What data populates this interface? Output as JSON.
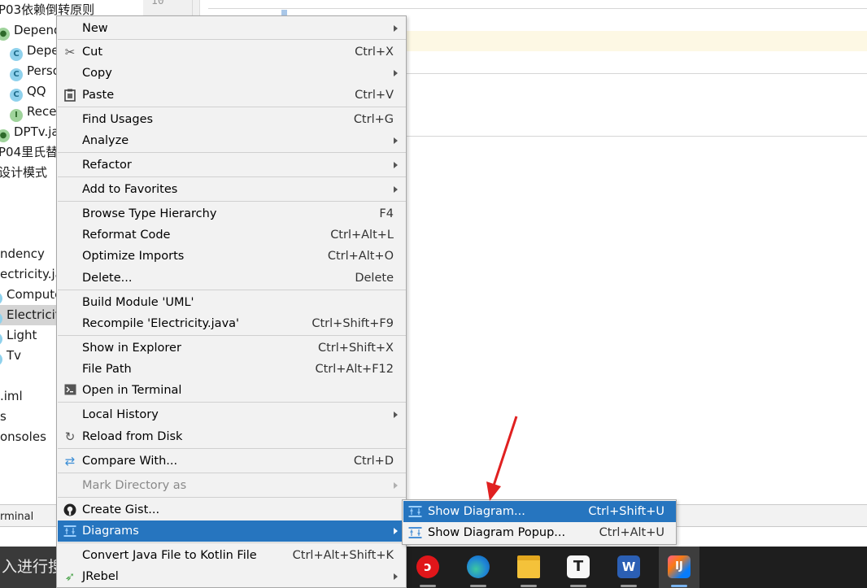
{
  "tree": {
    "rows": [
      {
        "label": "P03依赖倒转原则",
        "icon": ""
      },
      {
        "label": "Depend",
        "icon": "g"
      },
      {
        "label": "Depe",
        "icon": "c"
      },
      {
        "label": "Perso",
        "icon": "c"
      },
      {
        "label": "QQ",
        "icon": "c"
      },
      {
        "label": "Rece",
        "icon": "i"
      },
      {
        "label": "DPTv.jav",
        "icon": ""
      },
      {
        "label": "P04里氏替换",
        "icon": ""
      },
      {
        "label": "设计模式",
        "icon": ""
      },
      {
        "label": "ndency",
        "icon": ""
      },
      {
        "label": "ectricity.ja",
        "icon": ""
      },
      {
        "label": "Compute",
        "icon": "c"
      },
      {
        "label": "Electricit",
        "icon": "c"
      },
      {
        "label": "Light",
        "icon": "c"
      },
      {
        "label": "Tv",
        "icon": "c"
      },
      {
        "label": ".iml",
        "icon": ""
      },
      {
        "label": "s",
        "icon": ""
      },
      {
        "label": "onsoles",
        "icon": ""
      }
    ]
  },
  "gutter": {
    "line_number": "10"
  },
  "bottom": {
    "terminal_tab": "rminal"
  },
  "taskbar": {
    "search_text": "入进行搜索"
  },
  "context_menu": {
    "items": [
      {
        "label": "New",
        "shortcut": "",
        "submenu": true
      },
      {
        "label": "Cut",
        "shortcut": "Ctrl+X",
        "icon": "✂"
      },
      {
        "label": "Copy",
        "shortcut": "",
        "submenu": true
      },
      {
        "label": "Paste",
        "shortcut": "Ctrl+V",
        "icon": "📋"
      },
      {
        "label": "Find Usages",
        "shortcut": "Ctrl+G"
      },
      {
        "label": "Analyze",
        "shortcut": "",
        "submenu": true
      },
      {
        "label": "Refactor",
        "shortcut": "",
        "submenu": true
      },
      {
        "label": "Add to Favorites",
        "shortcut": "",
        "submenu": true
      },
      {
        "label": "Browse Type Hierarchy",
        "shortcut": "F4"
      },
      {
        "label": "Reformat Code",
        "shortcut": "Ctrl+Alt+L"
      },
      {
        "label": "Optimize Imports",
        "shortcut": "Ctrl+Alt+O"
      },
      {
        "label": "Delete...",
        "shortcut": "Delete"
      },
      {
        "label": "Build Module 'UML'",
        "shortcut": ""
      },
      {
        "label": "Recompile 'Electricity.java'",
        "shortcut": "Ctrl+Shift+F9"
      },
      {
        "label": "Show in Explorer",
        "shortcut": "Ctrl+Shift+X"
      },
      {
        "label": "File Path",
        "shortcut": "Ctrl+Alt+F12"
      },
      {
        "label": "Open in Terminal",
        "shortcut": ""
      },
      {
        "label": "Local History",
        "shortcut": "",
        "submenu": true
      },
      {
        "label": "Reload from Disk",
        "shortcut": ""
      },
      {
        "label": "Compare With...",
        "shortcut": "Ctrl+D"
      },
      {
        "label": "Mark Directory as",
        "shortcut": "",
        "submenu": true,
        "disabled": true
      },
      {
        "label": "Create Gist...",
        "shortcut": ""
      },
      {
        "label": "Diagrams",
        "shortcut": "",
        "submenu": true,
        "highlighted": true
      },
      {
        "label": "Convert Java File to Kotlin File",
        "shortcut": "Ctrl+Alt+Shift+K"
      },
      {
        "label": "JRebel",
        "shortcut": "",
        "submenu": true
      }
    ]
  },
  "submenu": {
    "items": [
      {
        "label": "Show Diagram...",
        "shortcut": "Ctrl+Shift+U",
        "highlighted": true
      },
      {
        "label": "Show Diagram Popup...",
        "shortcut": "Ctrl+Alt+U"
      }
    ]
  },
  "colors": {
    "highlight": "#2675bf",
    "menu_bg": "#f2f2f2",
    "pointer_arrow": "#e02020"
  }
}
